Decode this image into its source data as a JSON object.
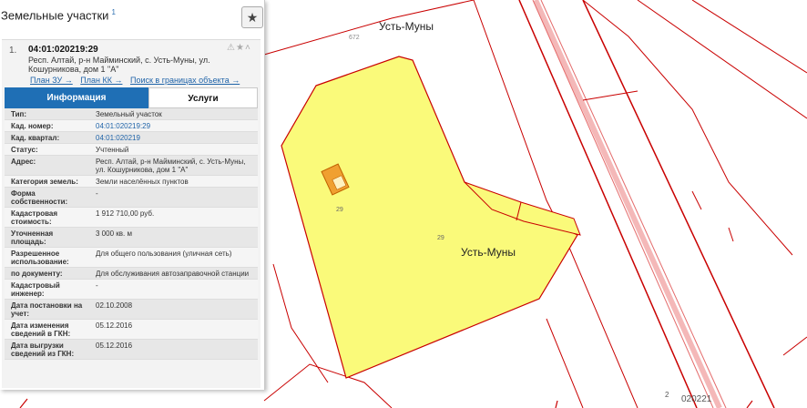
{
  "map": {
    "labels": {
      "settlement_top": "Усть-Муны",
      "settlement_parcel": "Усть-Муны",
      "quarter": "020221",
      "parcel_num_left": "29",
      "parcel_num_right": "29",
      "road_num": "672",
      "building_num": "2",
      "small_num": "2"
    },
    "colors": {
      "parcel_fill": "#fafa7a",
      "parcel_border": "#c90000",
      "building_fill": "#f0a030",
      "road_stripe": "#f4b8b8"
    }
  },
  "panel": {
    "title": "Земельные участки",
    "title_count": "1",
    "favorite_icon": "star-icon",
    "result": {
      "index": "1.",
      "number": "04:01:020219:29",
      "address": "Респ. Алтай, р-н Майминский, с. Усть-Муны, ул. Кошурникова, дом 1 \"А\"",
      "icons": "⚠★^",
      "links": [
        "План ЗУ →",
        "План КК →",
        "Поиск в границах объекта →"
      ]
    },
    "tabs": {
      "info": "Информация",
      "services": "Услуги"
    },
    "rows": [
      {
        "label": "Тип:",
        "value": "Земельный участок"
      },
      {
        "label": "Кад. номер:",
        "value": "04:01:020219:29"
      },
      {
        "label": "Кад. квартал:",
        "value": "04:01:020219"
      },
      {
        "label": "Статус:",
        "value": "Учтенный"
      },
      {
        "label": "Адрес:",
        "value": "Респ. Алтай, р-н Майминский, с. Усть-Муны, ул. Кошурникова, дом 1 \"А\""
      },
      {
        "label": "Категория земель:",
        "value": "Земли населённых пунктов"
      },
      {
        "label": "Форма собственности:",
        "value": "-"
      },
      {
        "label": "Кадастровая стоимость:",
        "value": "1 912 710,00 руб."
      },
      {
        "label": "Уточненная площадь:",
        "value": "3 000 кв. м"
      },
      {
        "label": "Разрешенное использование:",
        "value": "Для общего пользования (уличная сеть)"
      },
      {
        "label": "по документу:",
        "value": "Для обслуживания автозаправочной станции"
      },
      {
        "label": "Кадастровый инженер:",
        "value": "-"
      },
      {
        "label": "Дата постановки на учет:",
        "value": "02.10.2008"
      },
      {
        "label": "Дата изменения сведений в ГКН:",
        "value": "05.12.2016"
      },
      {
        "label": "Дата выгрузки сведений из ГКН:",
        "value": "05.12.2016"
      }
    ]
  }
}
